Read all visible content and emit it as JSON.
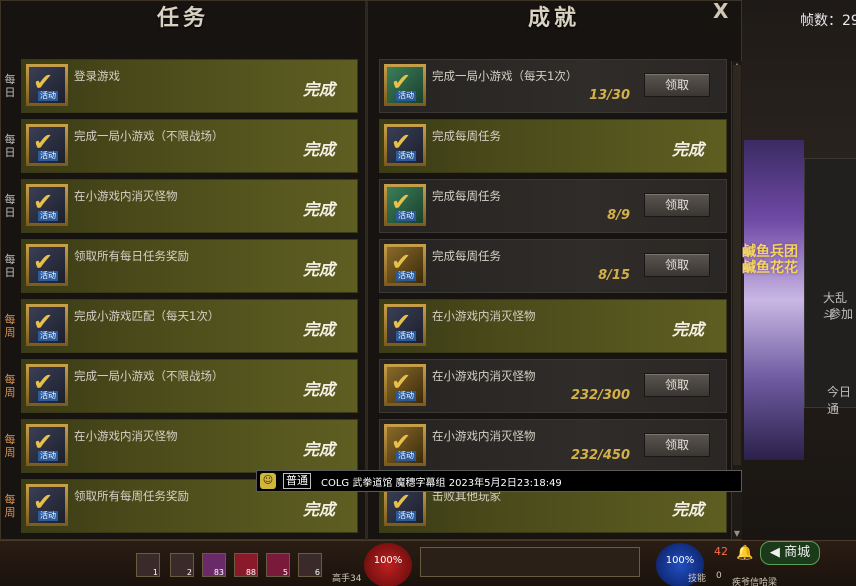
{
  "fps_label": "帧数：29",
  "window": {
    "tasks_title": "任务",
    "achievements_title": "成就",
    "close_label": "X"
  },
  "tasks": [
    {
      "period": "每日",
      "kind": "daily",
      "text": "登录游戏",
      "status": "完成"
    },
    {
      "period": "每日",
      "kind": "daily",
      "text": "完成一局小游戏（不限战场）",
      "status": "完成"
    },
    {
      "period": "每日",
      "kind": "daily",
      "text": "在小游戏内消灭怪物",
      "status": "完成"
    },
    {
      "period": "每日",
      "kind": "daily",
      "text": "领取所有每日任务奖励",
      "status": "完成"
    },
    {
      "period": "每周",
      "kind": "weekly",
      "text": "完成小游戏匹配（每天1次）",
      "status": "完成"
    },
    {
      "period": "每周",
      "kind": "weekly",
      "text": "完成一局小游戏（不限战场）",
      "status": "完成"
    },
    {
      "period": "每周",
      "kind": "weekly",
      "text": "在小游戏内消灭怪物",
      "status": "完成"
    },
    {
      "period": "每周",
      "kind": "weekly",
      "text": "领取所有每周任务奖励",
      "status": "完成"
    }
  ],
  "achievements": [
    {
      "text": "完成一局小游戏（每天1次）",
      "progress": "13/30",
      "button": "领取",
      "icon": "green"
    },
    {
      "text": "完成每周任务",
      "status": "完成",
      "icon": "default"
    },
    {
      "text": "完成每周任务",
      "progress": "8/9",
      "button": "领取",
      "icon": "green"
    },
    {
      "text": "完成每周任务",
      "progress": "8/15",
      "button": "领取",
      "icon": "gold"
    },
    {
      "text": "在小游戏内消灭怪物",
      "status": "完成",
      "icon": "default"
    },
    {
      "text": "在小游戏内消灭怪物",
      "progress": "232/300",
      "button": "领取",
      "icon": "gold"
    },
    {
      "text": "在小游戏内消灭怪物",
      "progress": "232/450",
      "button": "领取",
      "icon": "gold"
    },
    {
      "text": "击败其他玩家",
      "status": "完成",
      "icon": "default"
    }
  ],
  "icon_badge": "活动",
  "chat": {
    "channel": "普通",
    "message": "COLG 武拳道馆 魔穗字幕组 2023年5月2日23:18:49"
  },
  "side": {
    "banner_text": "鹹鱼兵团 鹹鱼花花",
    "panel_line1": "大乱斗",
    "panel_line2": "参加",
    "panel_line3": "今日通"
  },
  "hud": {
    "hp_label": "100%",
    "mp_label": "100%",
    "mall_label": "商城",
    "skill_label": "技能",
    "level_label": "高手34",
    "count_42": "42",
    "count_0": "0",
    "skill_counts": [
      "1",
      "2",
      "83",
      "88",
      "5",
      "6"
    ],
    "bottom_right": "疾爷信哈梁"
  },
  "colors": {
    "done_row": "#4c4c1b",
    "progress_text": "#d4b04a",
    "weekly_tag": "#d9955a"
  }
}
